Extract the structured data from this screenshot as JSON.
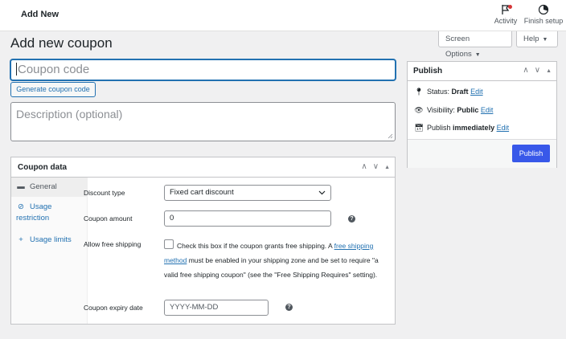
{
  "topbar": {
    "heading": "Add New",
    "activity_label": "Activity",
    "finish_label": "Finish setup"
  },
  "screen_options": {
    "screen_label": "Screen Options",
    "help_label": "Help"
  },
  "page": {
    "title": "Add new coupon"
  },
  "coupon": {
    "code_placeholder": "Coupon code",
    "generate_label": "Generate coupon code",
    "description_placeholder": "Description (optional)"
  },
  "publish": {
    "title": "Publish",
    "status_label": "Status:",
    "status_value": "Draft",
    "visibility_label": "Visibility:",
    "visibility_value": "Public",
    "publish_label": "Publish",
    "publish_value": "immediately",
    "edit_label": "Edit",
    "button_label": "Publish"
  },
  "coupon_data": {
    "title": "Coupon data",
    "tabs": [
      {
        "label": "General",
        "icon": "ticket-icon"
      },
      {
        "label": "Usage restriction",
        "icon": "block-icon"
      },
      {
        "label": "Usage limits",
        "icon": "plus-icon"
      }
    ],
    "discount_type_label": "Discount type",
    "discount_type_value": "Fixed cart discount",
    "coupon_amount_label": "Coupon amount",
    "coupon_amount_value": "0",
    "free_shipping_label": "Allow free shipping",
    "free_shipping_text_1": "Check this box if the coupon grants free shipping. A ",
    "free_shipping_link": "free shipping method",
    "free_shipping_text_2": " must be enabled in your shipping zone and be set to require \"a valid free shipping coupon\" (see the \"Free Shipping Requires\" setting).",
    "expiry_label": "Coupon expiry date",
    "expiry_placeholder": "YYYY-MM-DD"
  },
  "colors": {
    "accent": "#2271b1",
    "publish_button": "#3858e9",
    "background": "#f0f0f1"
  }
}
